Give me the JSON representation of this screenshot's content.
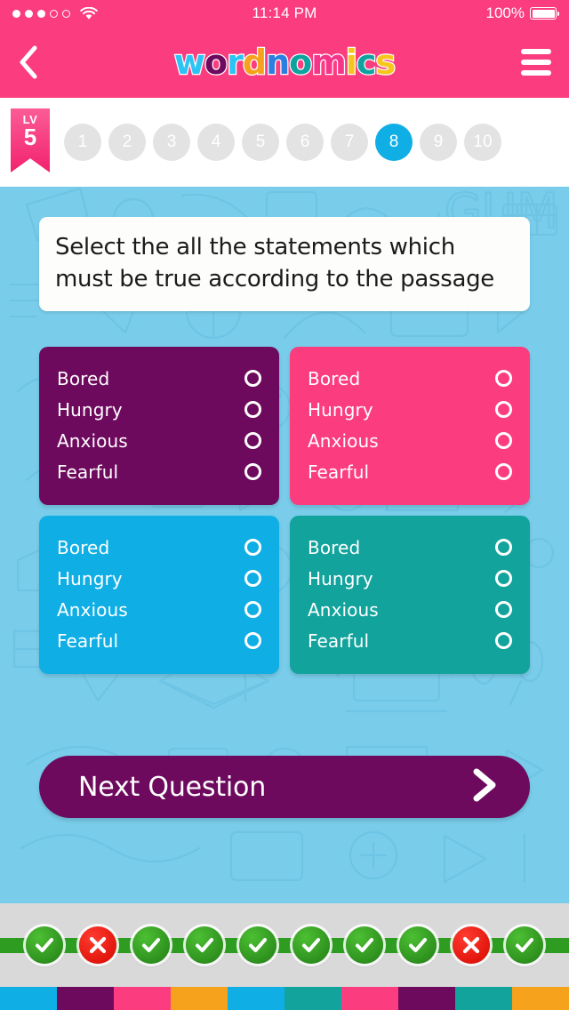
{
  "status_bar": {
    "time": "11:14 PM",
    "battery_percent": "100%",
    "signal_icon": "signal-dots-icon",
    "wifi_icon": "wifi-icon",
    "battery_icon": "battery-full-icon",
    "signal_filled": 3,
    "signal_total": 5
  },
  "nav": {
    "back_icon": "chevron-left-icon",
    "menu_icon": "hamburger-menu-icon",
    "logo_text": "wordnomics",
    "logo_letters": [
      {
        "ch": "w",
        "color": "#2BC4F3"
      },
      {
        "ch": "o",
        "color": "#6E0A5E"
      },
      {
        "ch": "r",
        "color": "#2BC4F3"
      },
      {
        "ch": "d",
        "color": "#F6A21D"
      },
      {
        "ch": "n",
        "color": "#2B7FE0"
      },
      {
        "ch": "o",
        "color": "#0FA3A0"
      },
      {
        "ch": "m",
        "color": "#F6358A"
      },
      {
        "ch": "i",
        "color": "#F6C61D"
      },
      {
        "ch": "c",
        "color": "#0FA3A0"
      },
      {
        "ch": "s",
        "color": "#F6C61D"
      }
    ],
    "bar_color": "#FB3C7F"
  },
  "level": {
    "label": "LV",
    "number": "5",
    "badge_color": "#F2226E"
  },
  "question_nav": {
    "items": [
      {
        "label": "1",
        "active": false
      },
      {
        "label": "2",
        "active": false
      },
      {
        "label": "3",
        "active": false
      },
      {
        "label": "4",
        "active": false
      },
      {
        "label": "5",
        "active": false
      },
      {
        "label": "6",
        "active": false
      },
      {
        "label": "7",
        "active": false
      },
      {
        "label": "8",
        "active": true
      },
      {
        "label": "9",
        "active": false
      },
      {
        "label": "10",
        "active": false
      }
    ],
    "active_color": "#0FAEE5",
    "inactive_color": "#e3e3e3"
  },
  "question": {
    "text": "Select the all the statements which must be true according to the passage"
  },
  "answer_cards": [
    {
      "color": "#6E0A5E",
      "name": "answer-card-purple",
      "options": [
        {
          "label": "Bored",
          "selected": false
        },
        {
          "label": "Hungry",
          "selected": false
        },
        {
          "label": "Anxious",
          "selected": false
        },
        {
          "label": "Fearful",
          "selected": false
        }
      ]
    },
    {
      "color": "#FB3C7F",
      "name": "answer-card-pink",
      "options": [
        {
          "label": "Bored",
          "selected": false
        },
        {
          "label": "Hungry",
          "selected": false
        },
        {
          "label": "Anxious",
          "selected": false
        },
        {
          "label": "Fearful",
          "selected": false
        }
      ]
    },
    {
      "color": "#0FAEE5",
      "name": "answer-card-blue",
      "options": [
        {
          "label": "Bored",
          "selected": false
        },
        {
          "label": "Hungry",
          "selected": false
        },
        {
          "label": "Anxious",
          "selected": false
        },
        {
          "label": "Fearful",
          "selected": false
        }
      ]
    },
    {
      "color": "#12A39C",
      "name": "answer-card-teal",
      "options": [
        {
          "label": "Bored",
          "selected": false
        },
        {
          "label": "Hungry",
          "selected": false
        },
        {
          "label": "Anxious",
          "selected": false
        },
        {
          "label": "Fearful",
          "selected": false
        }
      ]
    }
  ],
  "next_button": {
    "label": "Next Question",
    "icon": "chevron-right-icon",
    "color": "#6E0A5E"
  },
  "score_bar": {
    "results": [
      "correct",
      "wrong",
      "correct",
      "correct",
      "correct",
      "correct",
      "correct",
      "correct",
      "wrong",
      "correct"
    ],
    "correct_color": "#2c8e1d",
    "wrong_color": "#e0140b",
    "track_color": "#2e9c20",
    "correct_icon": "check-icon",
    "wrong_icon": "cross-icon"
  },
  "bottom_tiles": {
    "colors": [
      "#0FAEE5",
      "#6E0A5E",
      "#FB3C7F",
      "#F6A21D",
      "#0FAEE5",
      "#12A39C",
      "#FB3C7F",
      "#6E0A5E",
      "#12A39C",
      "#F6A21D"
    ]
  },
  "background": {
    "color": "#79CDEA",
    "pattern": "doodle-line-art"
  }
}
